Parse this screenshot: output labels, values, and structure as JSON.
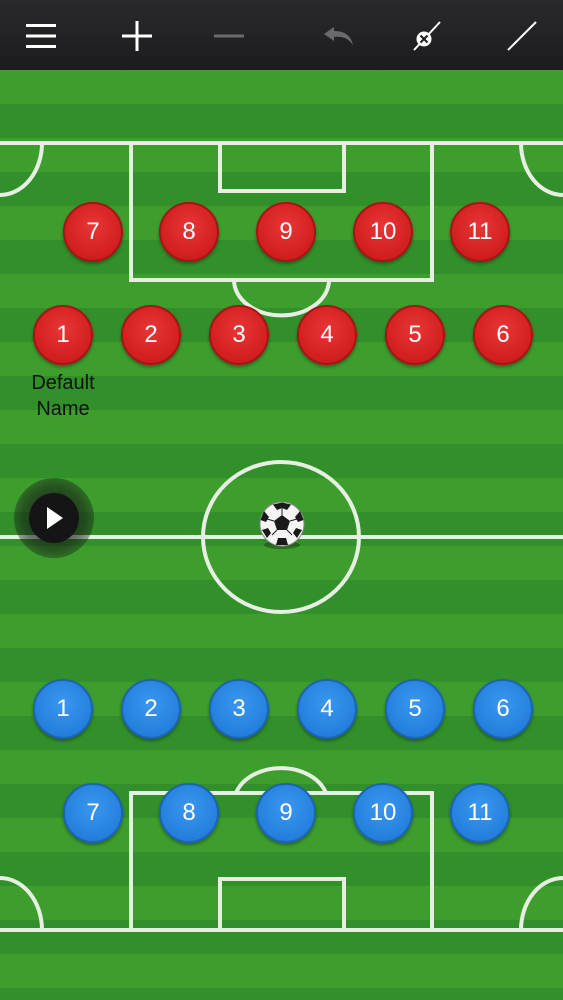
{
  "toolbar": {
    "buttons": [
      {
        "icon": "menu-icon"
      },
      {
        "icon": "plus-icon"
      },
      {
        "icon": "minus-icon"
      },
      {
        "icon": "undo-icon"
      },
      {
        "icon": "erase-line-icon"
      },
      {
        "icon": "draw-line-icon"
      }
    ]
  },
  "colors": {
    "toolbar_bg": "#1f1f21",
    "pitch_light": "#3d9e2e",
    "pitch_dark": "#32902a",
    "team_red": "#d11f1f",
    "team_blue": "#2580dd",
    "line": "#e6efe2"
  },
  "team_red": {
    "players": [
      {
        "number": "1"
      },
      {
        "number": "2"
      },
      {
        "number": "3"
      },
      {
        "number": "4"
      },
      {
        "number": "5"
      },
      {
        "number": "6"
      },
      {
        "number": "7"
      },
      {
        "number": "8"
      },
      {
        "number": "9"
      },
      {
        "number": "10"
      },
      {
        "number": "11"
      }
    ],
    "selected_name_line1": "Default",
    "selected_name_line2": "Name"
  },
  "team_blue": {
    "players": [
      {
        "number": "1"
      },
      {
        "number": "2"
      },
      {
        "number": "3"
      },
      {
        "number": "4"
      },
      {
        "number": "5"
      },
      {
        "number": "6"
      },
      {
        "number": "7"
      },
      {
        "number": "8"
      },
      {
        "number": "9"
      },
      {
        "number": "10"
      },
      {
        "number": "11"
      }
    ]
  },
  "controls": {
    "play_icon": "play-icon",
    "ball_icon": "soccer-ball-icon"
  }
}
